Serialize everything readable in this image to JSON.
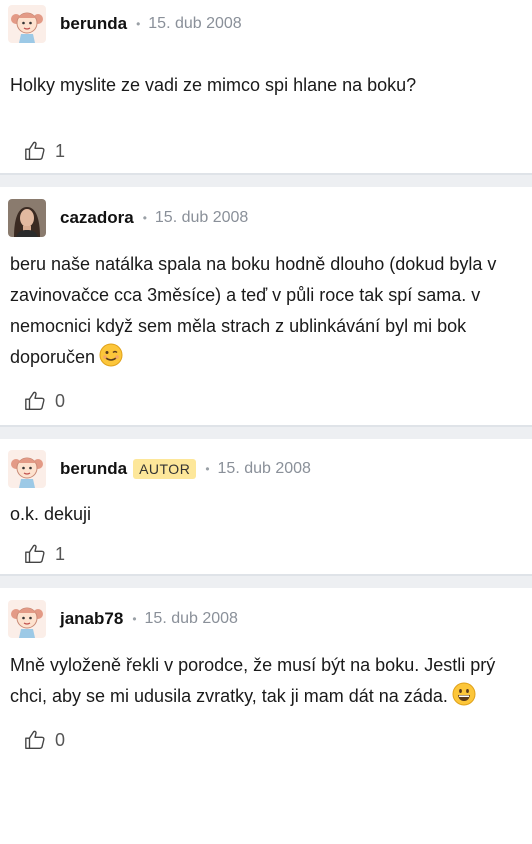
{
  "posts": [
    {
      "author": "berunda",
      "badge": "",
      "date": "15. dub 2008",
      "avatar_icon": "baby-girl-avatar-icon",
      "text": "Holky myslite ze vadi ze mimco spi hlane na boku?",
      "emoji": "",
      "likes": "1"
    },
    {
      "author": "cazadora",
      "badge": "",
      "date": "15. dub 2008",
      "avatar_icon": "profile-photo-avatar",
      "text": "beru naše natálka spala na boku hodně dlouho (dokud byla v zavinovačce cca 3měsíce) a teď v půli roce tak spí sama. v nemocnici když sem měla strach z ublinkávání byl mi bok doporučen",
      "emoji": "wink-emoji-icon",
      "likes": "0"
    },
    {
      "author": "berunda",
      "badge": "AUTOR",
      "date": "15. dub 2008",
      "avatar_icon": "baby-girl-avatar-icon",
      "text": "o.k. dekuji",
      "emoji": "",
      "likes": "1"
    },
    {
      "author": "janab78",
      "badge": "",
      "date": "15. dub 2008",
      "avatar_icon": "baby-girl-avatar-icon",
      "text": "Mně vyloženě řekli v porodce, že musí být na boku. Jestli prý chci, aby se mi udusila zvratky, tak ji mam dát na záda.",
      "emoji": "grin-emoji-icon",
      "likes": "0"
    }
  ],
  "colors": {
    "separator": "#edeff2",
    "badge_bg": "#fde79a",
    "date": "#8a9099"
  }
}
